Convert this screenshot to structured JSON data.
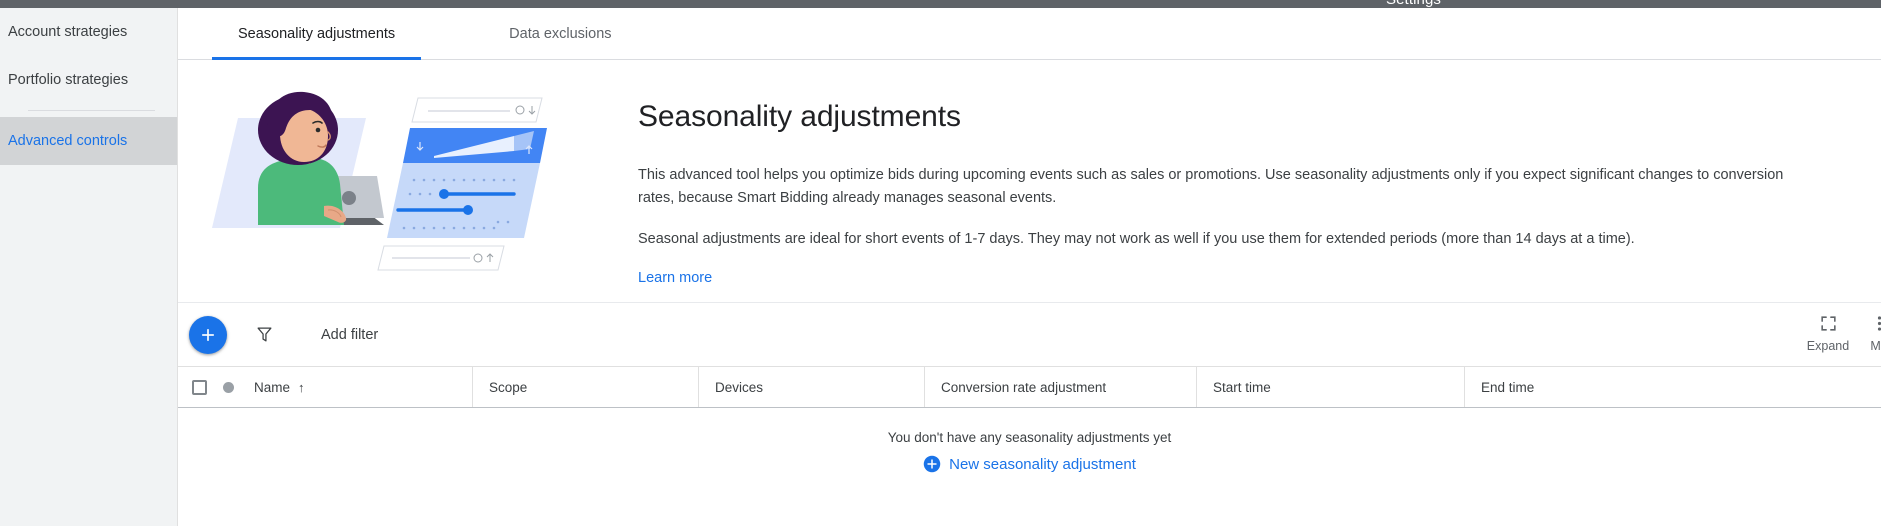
{
  "topbar": {
    "title": "Settings"
  },
  "sidebar": {
    "items": [
      {
        "label": "Account strategies",
        "selected": false
      },
      {
        "label": "Portfolio strategies",
        "selected": false
      },
      {
        "label": "Advanced controls",
        "selected": true
      }
    ]
  },
  "tabs": [
    {
      "label": "Seasonality adjustments",
      "active": true
    },
    {
      "label": "Data exclusions",
      "active": false
    }
  ],
  "hero": {
    "title": "Seasonality adjustments",
    "paragraph1": "This advanced tool helps you optimize bids during upcoming events such as sales or promotions. Use seasonality adjustments only if you expect significant changes to conversion rates, because Smart Bidding already manages seasonal events.",
    "paragraph2": "Seasonal adjustments are ideal for short events of 1-7 days. They may not work as well if you use them for extended periods (more than 14 days at a time).",
    "link": "Learn more"
  },
  "toolbar": {
    "add_button_icon": "plus-icon",
    "filter_icon": "filter-icon",
    "add_filter_label": "Add filter",
    "expand_label": "Expand",
    "more_label": "Mo"
  },
  "table": {
    "columns": [
      "Name",
      "Scope",
      "Devices",
      "Conversion rate adjustment",
      "Start time",
      "End time"
    ],
    "sort_indicator": "↑",
    "empty_message": "You don't have any seasonality adjustments yet",
    "empty_action": "New seasonality adjustment"
  },
  "colors": {
    "accent": "#1a73e8",
    "topbar": "#5f6368",
    "sidebar_bg": "#f1f3f4",
    "sidebar_selected_bg": "#d2d4d6",
    "text_primary": "#202124",
    "text_secondary": "#5f6368"
  }
}
